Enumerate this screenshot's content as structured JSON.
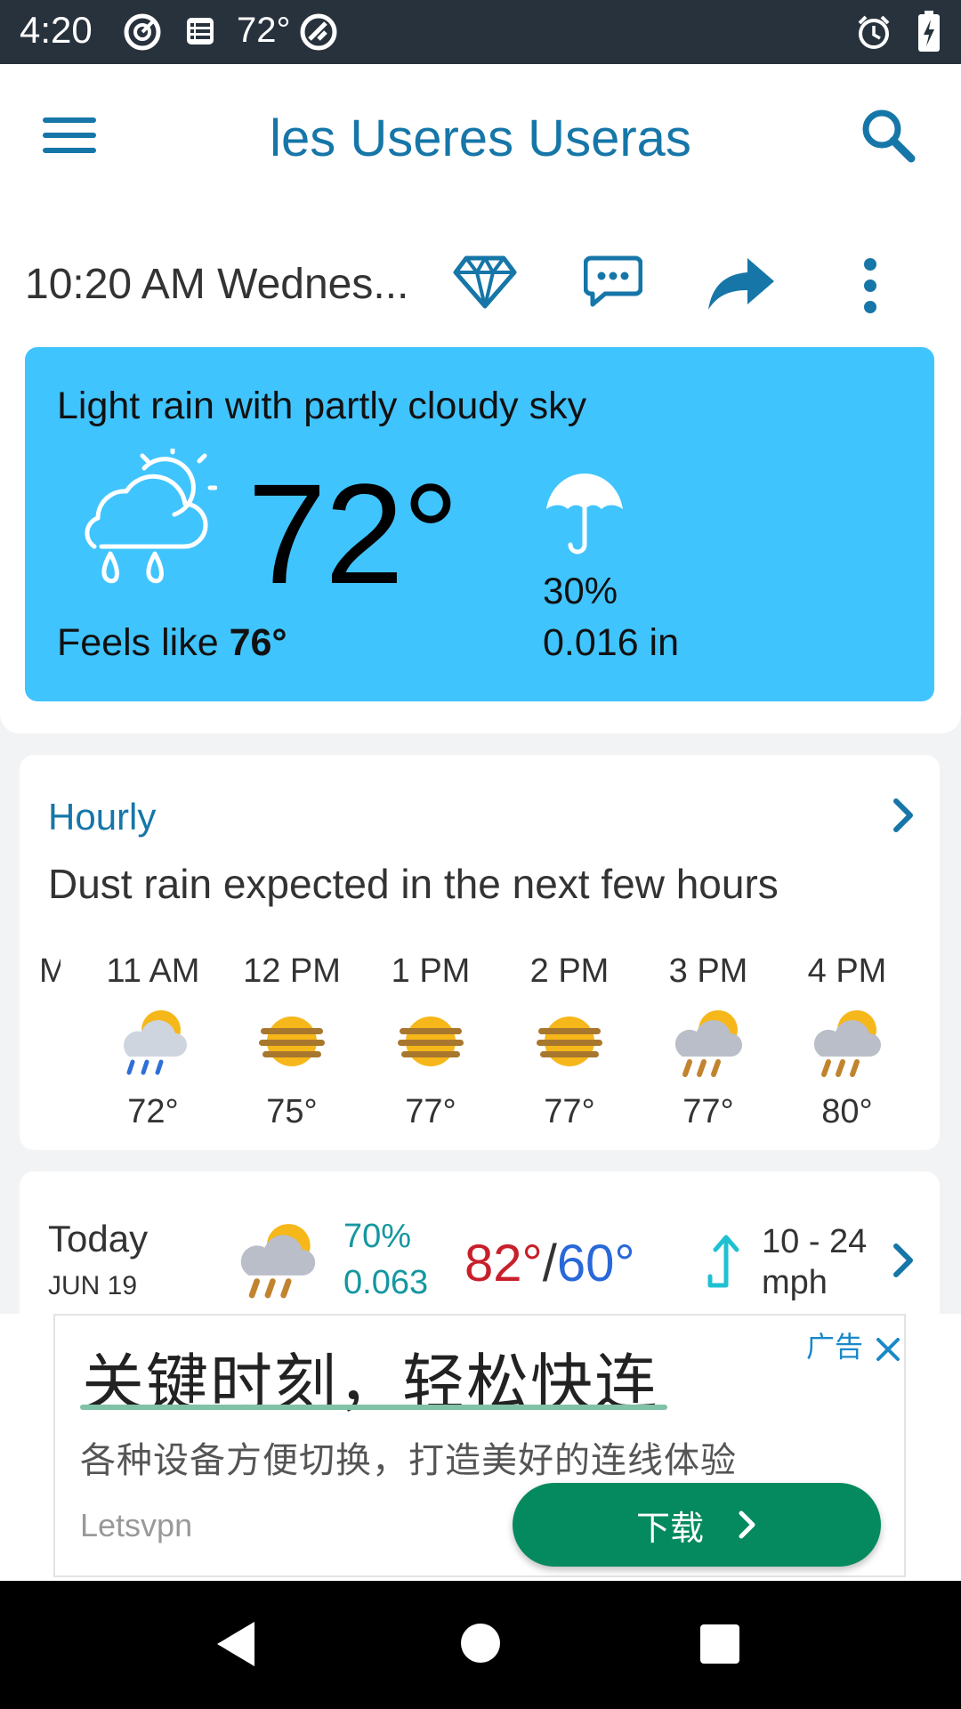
{
  "status_bar": {
    "time": "4:20",
    "temperature": "72°"
  },
  "app_bar": {
    "title": "les Useres Useras"
  },
  "info_row": {
    "datetime": "10:20 AM  Wednes..."
  },
  "current": {
    "condition": "Light rain with partly cloudy sky",
    "temperature": "72°",
    "feels_like_label": "Feels like",
    "feels_like_value": "76°",
    "precip_chance": "30%",
    "precip_amount": "0.016 in"
  },
  "hourly": {
    "label": "Hourly",
    "summary": "Dust rain expected in the next few hours",
    "partial_time": "M",
    "items": [
      {
        "time": "11 AM",
        "icon": "rain-partly-sunny-icon",
        "temp": "72°"
      },
      {
        "time": "12 PM",
        "icon": "sun-haze-icon",
        "temp": "75°"
      },
      {
        "time": "1 PM",
        "icon": "sun-haze-icon",
        "temp": "77°"
      },
      {
        "time": "2 PM",
        "icon": "sun-haze-icon",
        "temp": "77°"
      },
      {
        "time": "3 PM",
        "icon": "dust-rain-icon",
        "temp": "77°"
      },
      {
        "time": "4 PM",
        "icon": "dust-rain-icon",
        "temp": "80°"
      }
    ]
  },
  "daily": {
    "day": "Today",
    "date": "JUN 19",
    "precip_chance": "70%",
    "precip_amount": "0.063",
    "high": "82°",
    "separator": "/",
    "low": "60°",
    "wind_range": "10 - 24",
    "wind_unit": "mph"
  },
  "ad": {
    "headline": "关键时刻，轻松快连",
    "subline": "各种设备方便切换，打造美好的连线体验",
    "brand": "Letsvpn",
    "tag": "广告",
    "cta": "下载"
  },
  "colors": {
    "accent": "#1676a8",
    "card_blue": "#40c4fe",
    "high_temp": "#c8202a",
    "low_temp": "#2968d9",
    "ad_green": "#048a5e"
  }
}
